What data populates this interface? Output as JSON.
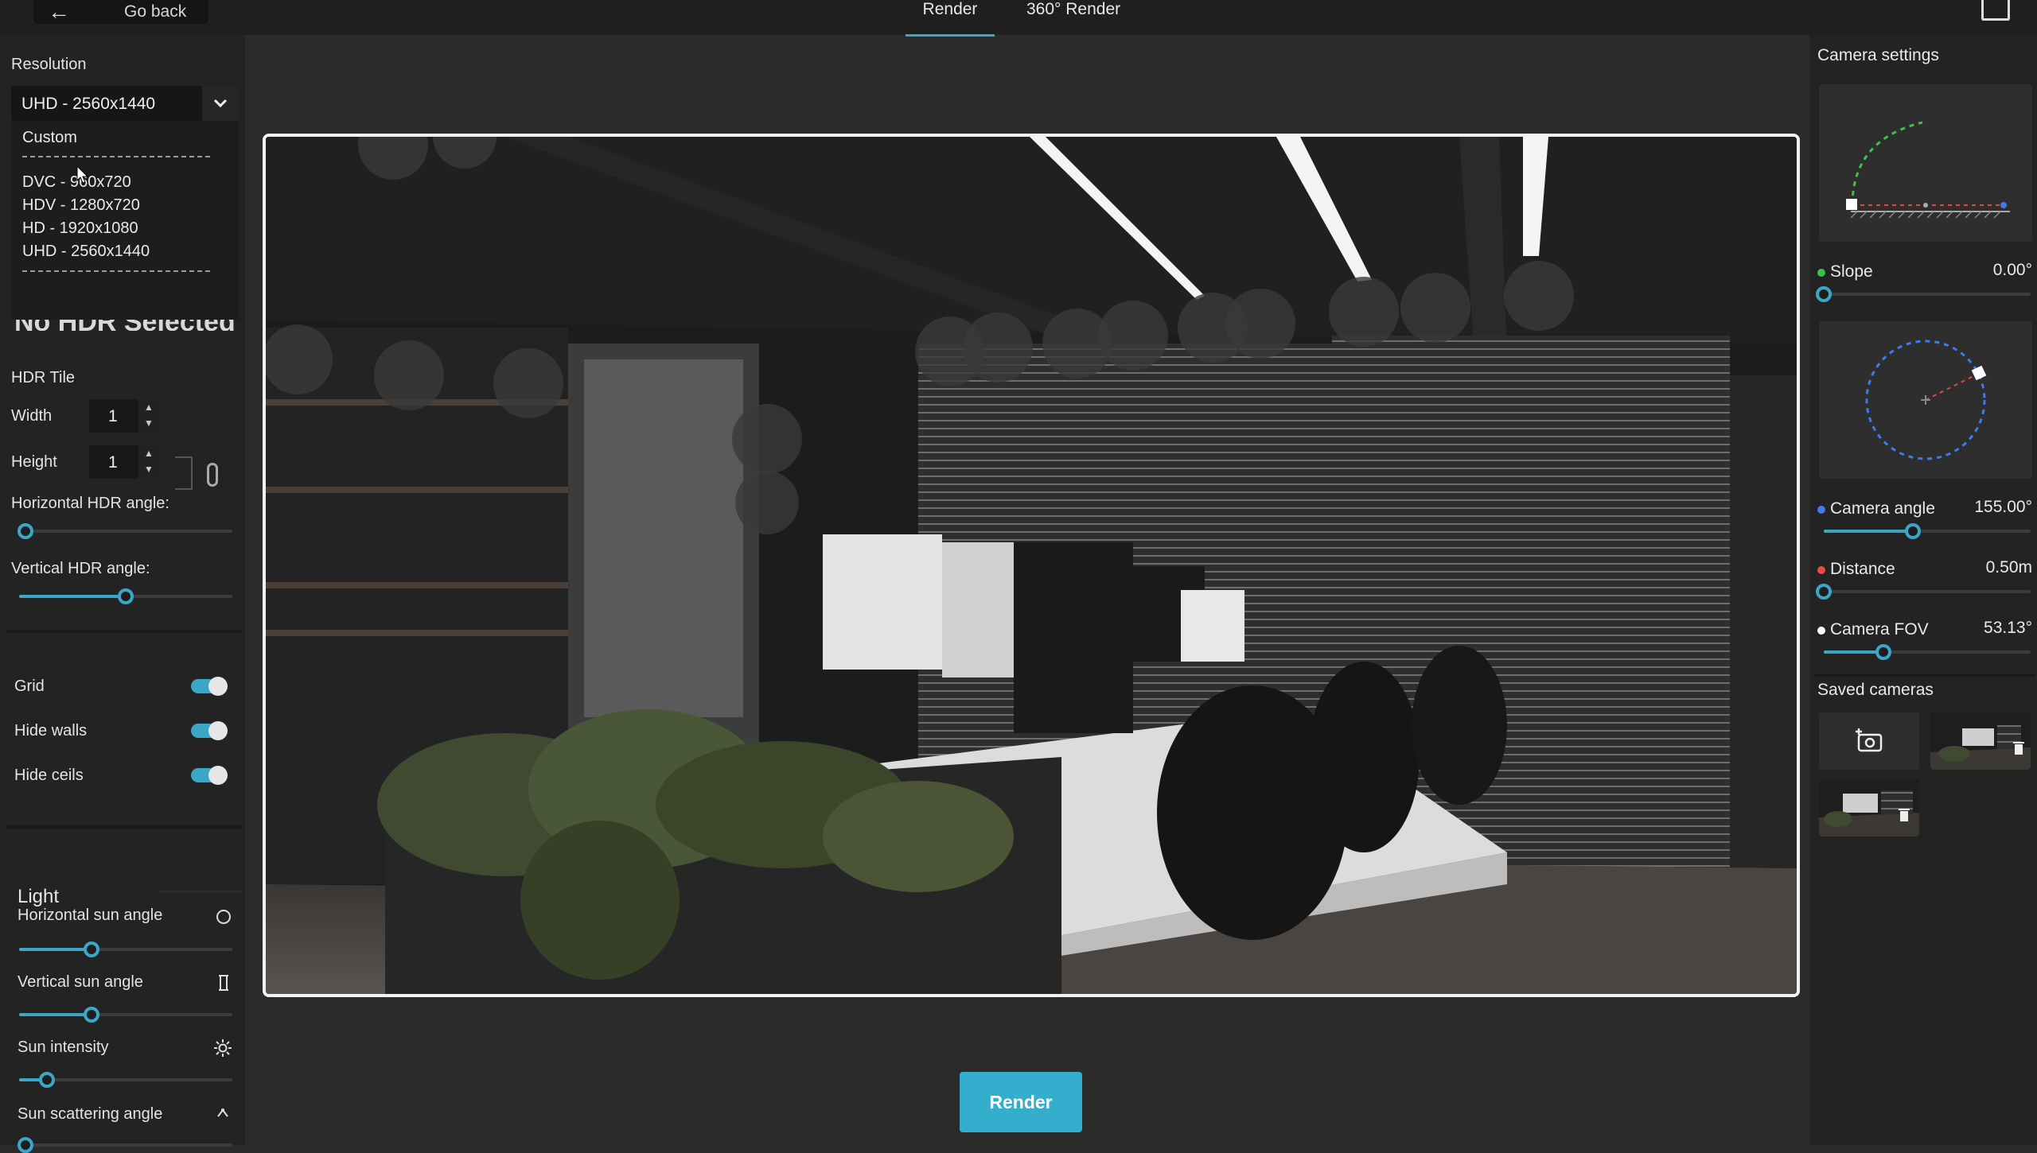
{
  "topbar": {
    "go_back": "Go back",
    "tabs": [
      "Render",
      "360° Render"
    ],
    "active_tab": "Render"
  },
  "left": {
    "resolution_label": "Resolution",
    "resolution_value": "UHD - 2560x1440",
    "dropdown": {
      "custom": "Custom",
      "options": [
        "DVC - 960x720",
        "HDV - 1280x720",
        "HD - 1920x1080",
        "UHD - 2560x1440"
      ]
    },
    "no_hdr": "No HDR Selected",
    "hdr_tile": "HDR Tile",
    "width_label": "Width",
    "width_value": "1",
    "height_label": "Height",
    "height_value": "1",
    "horizontal_hdr_angle": "Horizontal HDR angle:",
    "horizontal_hdr_level": 0.03,
    "vertical_hdr_angle": "Vertical HDR angle:",
    "vertical_hdr_level": 0.5,
    "toggles": [
      {
        "label": "Grid",
        "on": true
      },
      {
        "label": "Hide walls",
        "on": true
      },
      {
        "label": "Hide ceils",
        "on": true
      }
    ],
    "light_title": "Light",
    "light_controls": [
      {
        "label": "Horizontal sun angle",
        "icon": "circle-icon",
        "level": 0.34
      },
      {
        "label": "Vertical sun angle",
        "icon": "pillar-icon",
        "level": 0.34
      },
      {
        "label": "Sun intensity",
        "icon": "sun-icon",
        "level": 0.13
      },
      {
        "label": "Sun scattering angle",
        "icon": "scatter-icon",
        "level": 0.03
      }
    ]
  },
  "render_button": "Render",
  "right": {
    "camera_settings": "Camera settings",
    "params": [
      {
        "label": "Slope",
        "value": "0.00°",
        "color": "#3cc24a",
        "level": 0.0
      },
      {
        "label": "Camera angle",
        "value": "155.00°",
        "color": "#3c7bf0",
        "level": 0.43
      },
      {
        "label": "Distance",
        "value": "0.50m",
        "color": "#f04848",
        "level": 0.0
      },
      {
        "label": "Camera FOV",
        "value": "53.13°",
        "color": "#ffffff",
        "level": 0.29
      }
    ],
    "saved_cameras": "Saved cameras"
  },
  "colors": {
    "accent": "#3aa7c9",
    "button": "#35aecd"
  }
}
